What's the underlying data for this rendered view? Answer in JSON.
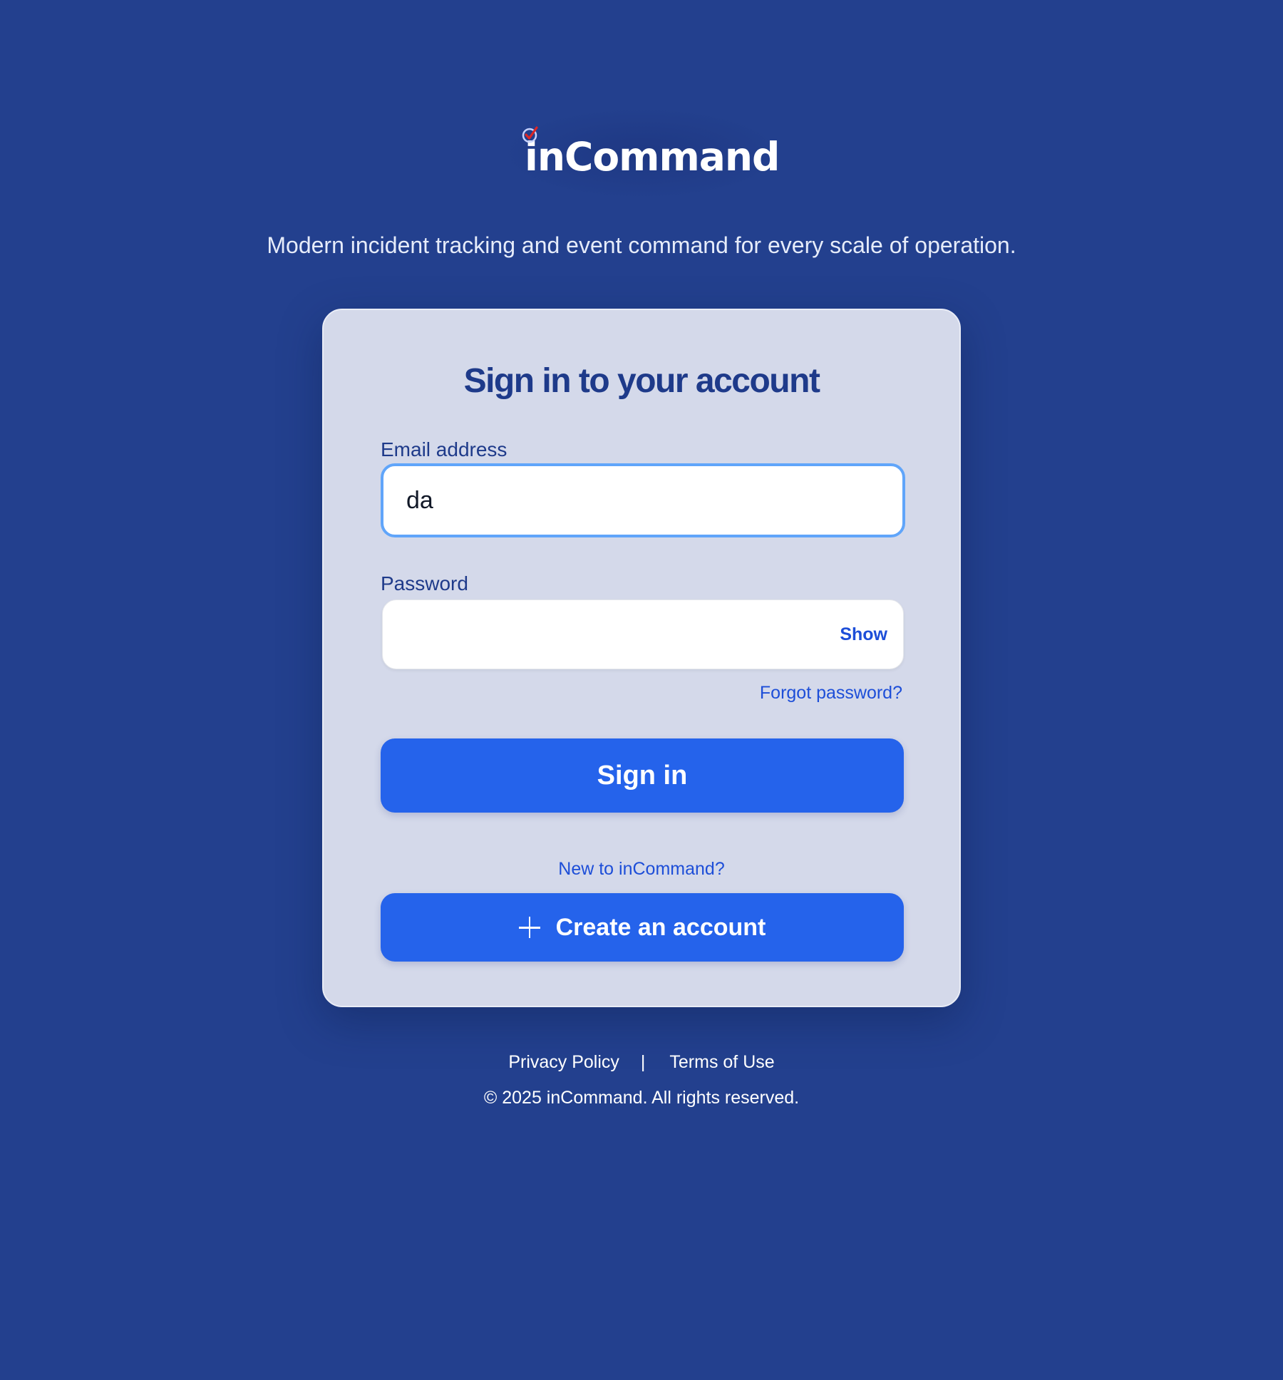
{
  "brand": {
    "name": "inCommand",
    "badge_color": "#dc2626"
  },
  "tagline": "Modern incident tracking and event command for every scale of operation.",
  "form": {
    "title": "Sign in to your account",
    "email_label": "Email address",
    "email_value": "da",
    "password_label": "Password",
    "password_value": "",
    "show_label": "Show",
    "forgot_label": "Forgot password?",
    "signin_label": "Sign in",
    "new_prompt": "New to inCommand?",
    "create_label": "Create an account"
  },
  "footer": {
    "privacy": "Privacy Policy",
    "separator": "|",
    "terms": "Terms of Use",
    "copyright": "© 2025 inCommand. All rights reserved."
  },
  "colors": {
    "background": "#23408e",
    "card": "#d4d9ea",
    "primary": "#2563eb",
    "link": "#1d4ed8",
    "focus_ring": "#60a5fa"
  }
}
